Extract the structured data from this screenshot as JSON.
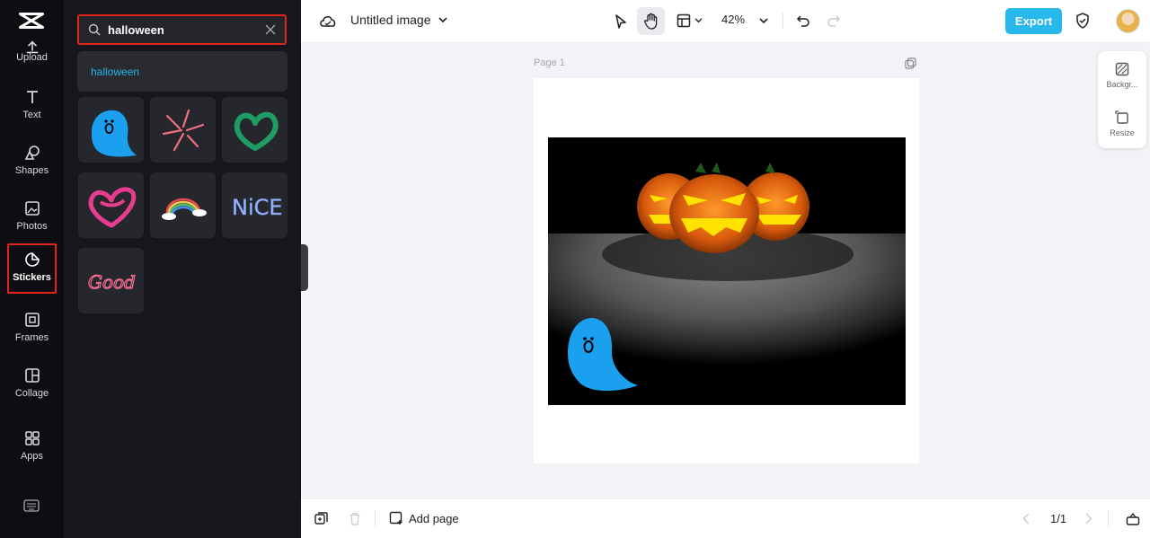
{
  "sidebar": {
    "items": [
      {
        "label": "Upload",
        "icon": "upload-icon"
      },
      {
        "label": "Text",
        "icon": "text-icon"
      },
      {
        "label": "Shapes",
        "icon": "shapes-icon"
      },
      {
        "label": "Photos",
        "icon": "photos-icon"
      },
      {
        "label": "Stickers",
        "icon": "stickers-icon",
        "active": true
      },
      {
        "label": "Frames",
        "icon": "frames-icon"
      },
      {
        "label": "Collage",
        "icon": "collage-icon"
      },
      {
        "label": "Apps",
        "icon": "apps-icon"
      }
    ]
  },
  "search": {
    "value": "halloween"
  },
  "suggestion": "halloween",
  "stickers": [
    "blue-ghost",
    "pink-sparkle",
    "green-heart",
    "pink-heart",
    "rainbow-cloud",
    "nice-text",
    "good-text"
  ],
  "topbar": {
    "title": "Untitled image",
    "zoom": "42%",
    "export_label": "Export"
  },
  "canvas": {
    "page_label": "Page 1"
  },
  "right_panel": {
    "background_label": "Backgr...",
    "resize_label": "Resize"
  },
  "bottom": {
    "add_page_label": "Add page",
    "pager": "1/1"
  },
  "colors": {
    "accent": "#28b8eb",
    "highlight": "#e1251b",
    "panel": "#16161c"
  }
}
